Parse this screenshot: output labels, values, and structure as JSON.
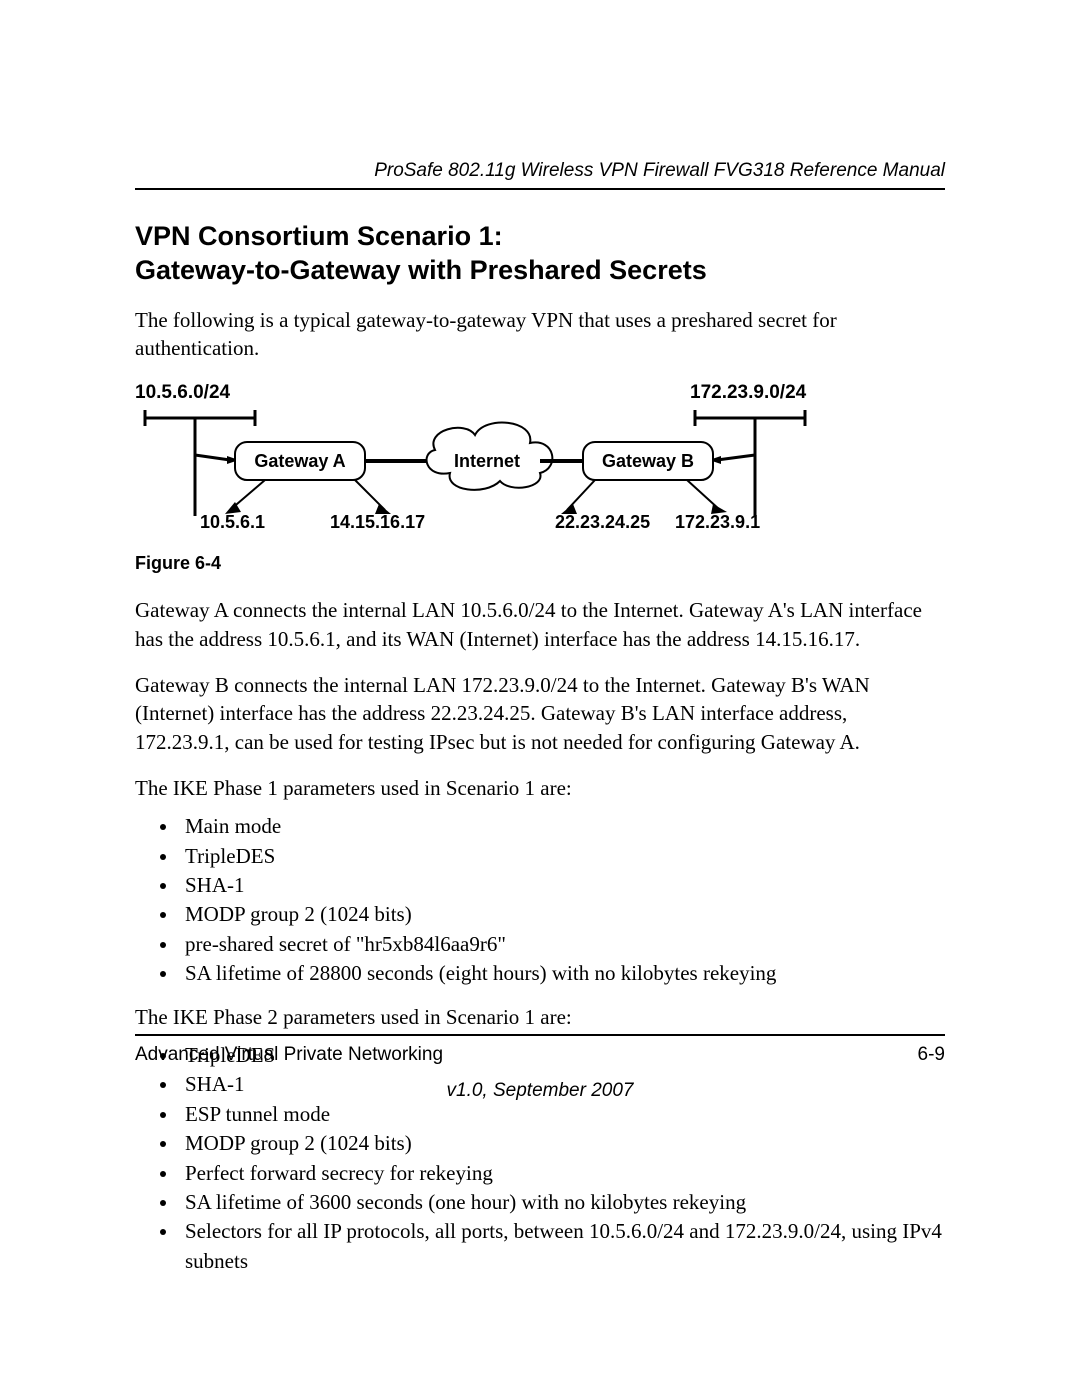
{
  "header": {
    "running_title": "ProSafe 802.11g Wireless VPN Firewall FVG318 Reference Manual"
  },
  "section": {
    "title_line1": "VPN Consortium Scenario 1:",
    "title_line2": "Gateway-to-Gateway with Preshared Secrets"
  },
  "intro": "The following is a typical gateway-to-gateway VPN that uses a preshared secret for authentication.",
  "diagram": {
    "net_a": "10.5.6.0/24",
    "net_b": "172.23.9.0/24",
    "gw_a": "Gateway A",
    "gw_b": "Gateway B",
    "internet": "Internet",
    "lan_a_ip": "10.5.6.1",
    "wan_a_ip": "14.15.16.17",
    "wan_b_ip": "22.23.24.25",
    "lan_b_ip": "172.23.9.1"
  },
  "figure_caption": "Figure 6-4",
  "para_gw_a": "Gateway A connects the internal LAN 10.5.6.0/24 to the Internet. Gateway A's LAN interface has the address 10.5.6.1, and its WAN (Internet) interface has the address 14.15.16.17.",
  "para_gw_b": "Gateway B connects the internal LAN 172.23.9.0/24 to the Internet. Gateway B's WAN (Internet) interface has the address 22.23.24.25. Gateway B's LAN interface address, 172.23.9.1, can be used for testing IPsec but is not needed for configuring Gateway A.",
  "phase1_intro": "The IKE Phase 1 parameters used in Scenario 1 are:",
  "phase1": [
    "Main mode",
    "TripleDES",
    "SHA-1",
    "MODP group 2 (1024 bits)",
    "pre-shared secret of \"hr5xb84l6aa9r6\"",
    "SA lifetime of 28800 seconds (eight hours) with no kilobytes rekeying"
  ],
  "phase2_intro": "The IKE Phase 2 parameters used in Scenario 1 are:",
  "phase2": [
    "TripleDES",
    "SHA-1",
    "ESP tunnel mode",
    "MODP group 2 (1024 bits)",
    "Perfect forward secrecy for rekeying",
    "SA lifetime of 3600 seconds (one hour) with no kilobytes rekeying",
    "Selectors for all IP protocols, all ports, between 10.5.6.0/24 and 172.23.9.0/24, using IPv4 subnets"
  ],
  "footer": {
    "left": "Advanced Virtual Private Networking",
    "right": "6-9",
    "version": "v1.0, September 2007"
  }
}
